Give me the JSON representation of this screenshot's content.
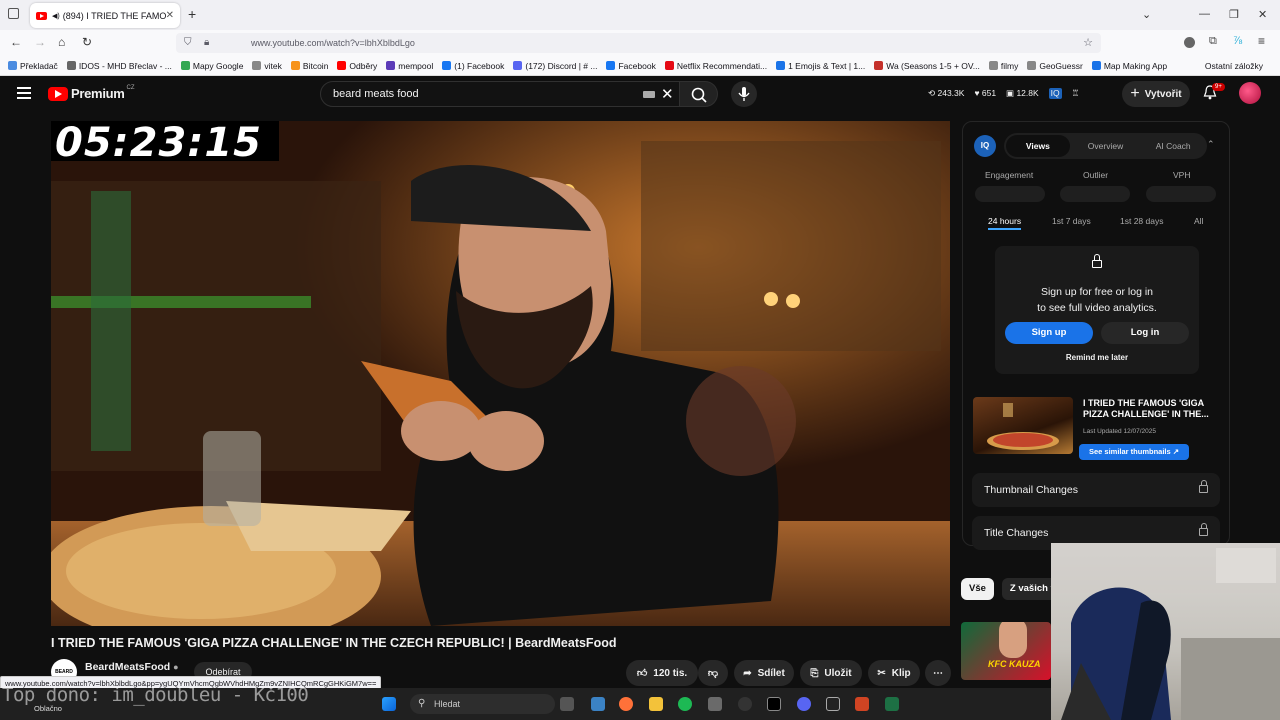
{
  "browser": {
    "tab_title": "(894) I TRIED THE FAMOUS",
    "url": "www.youtube.com/watch?v=lbhXblbdLgo",
    "bookmarks": [
      {
        "label": "Překladač",
        "color": "#4a8be0"
      },
      {
        "label": "IDOS - MHD Břeclav - ...",
        "color": "#666666"
      },
      {
        "label": "Mapy Google",
        "color": "#34a853"
      },
      {
        "label": "vitek",
        "color": "#888888"
      },
      {
        "label": "Bitcoin",
        "color": "#f7931a"
      },
      {
        "label": "Odběry",
        "color": "#ff0000"
      },
      {
        "label": "mempool",
        "color": "#5c3bb8"
      },
      {
        "label": "(1) Facebook",
        "color": "#1877f2"
      },
      {
        "label": "(172) Discord | # ...",
        "color": "#5865f2"
      },
      {
        "label": "Facebook",
        "color": "#1877f2"
      },
      {
        "label": "Netflix Recommendati...",
        "color": "#e50914"
      },
      {
        "label": "1 Emojis & Text | 1...",
        "color": "#1a73e8"
      },
      {
        "label": "Wa (Seasons 1-5 + OV...",
        "color": "#c4302b"
      },
      {
        "label": "filmy",
        "color": "#888888"
      },
      {
        "label": "GeoGuessr",
        "color": "#888888"
      },
      {
        "label": "Map Making App",
        "color": "#1a73e8"
      }
    ],
    "other_bookmarks": "Ostatní záložky"
  },
  "youtube": {
    "logo_text": "Premium",
    "country": "CZ",
    "search_value": "beard meats food",
    "header_stats": [
      "243.3K",
      "651",
      "12.8K"
    ],
    "create_label": "Vytvořit",
    "notif_badge": "9+"
  },
  "video": {
    "timer": "05:23:15",
    "title": "I TRIED THE FAMOUS 'GIGA PIZZA CHALLENGE' IN THE CZECH REPUBLIC! | BeardMeatsFood",
    "channel": "BeardMeatsFood",
    "channel_avatar_text": "BEARD MEATS",
    "subscribe_label": "Odebírat",
    "likes": "120 tis.",
    "share_label": "Sdílet",
    "save_label": "Uložit",
    "clip_label": "Klip",
    "status_url": "www.youtube.com/watch?v=lbhXblbdLgo&pp=ygUQYmVhcmQgbWVhdHMgZm9vZNIHCQmRCgGHKiGM7w=="
  },
  "panel": {
    "badge": "IQ",
    "tabs": [
      "Views",
      "Overview",
      "AI Coach"
    ],
    "metrics": [
      "Engagement",
      "Outlier",
      "VPH"
    ],
    "ranges": [
      "24 hours",
      "1st 7 days",
      "1st 28 days",
      "All"
    ],
    "lock_line1": "Sign up for free or log in",
    "lock_line2": "to see full video analytics.",
    "signup_label": "Sign up",
    "login_label": "Log in",
    "remind_label": "Remind me later",
    "thumb_title": "I TRIED THE FAMOUS 'GIGA PIZZA CHALLENGE' IN THE...",
    "last_updated": "Last Updated 12/07/2025",
    "similar_label": "See similar thumbnails ↗",
    "locked_rows": [
      "Thumbnail Changes",
      "Title Changes"
    ]
  },
  "feed": {
    "chips": [
      "Vše",
      "Z vašich vy"
    ],
    "rec_thumb_text": "KFC KAUZA"
  },
  "taskbar": {
    "overlay": "Top dono: im_doubleu - Kč100",
    "weather": "Oblačno",
    "search_placeholder": "Hledat"
  }
}
